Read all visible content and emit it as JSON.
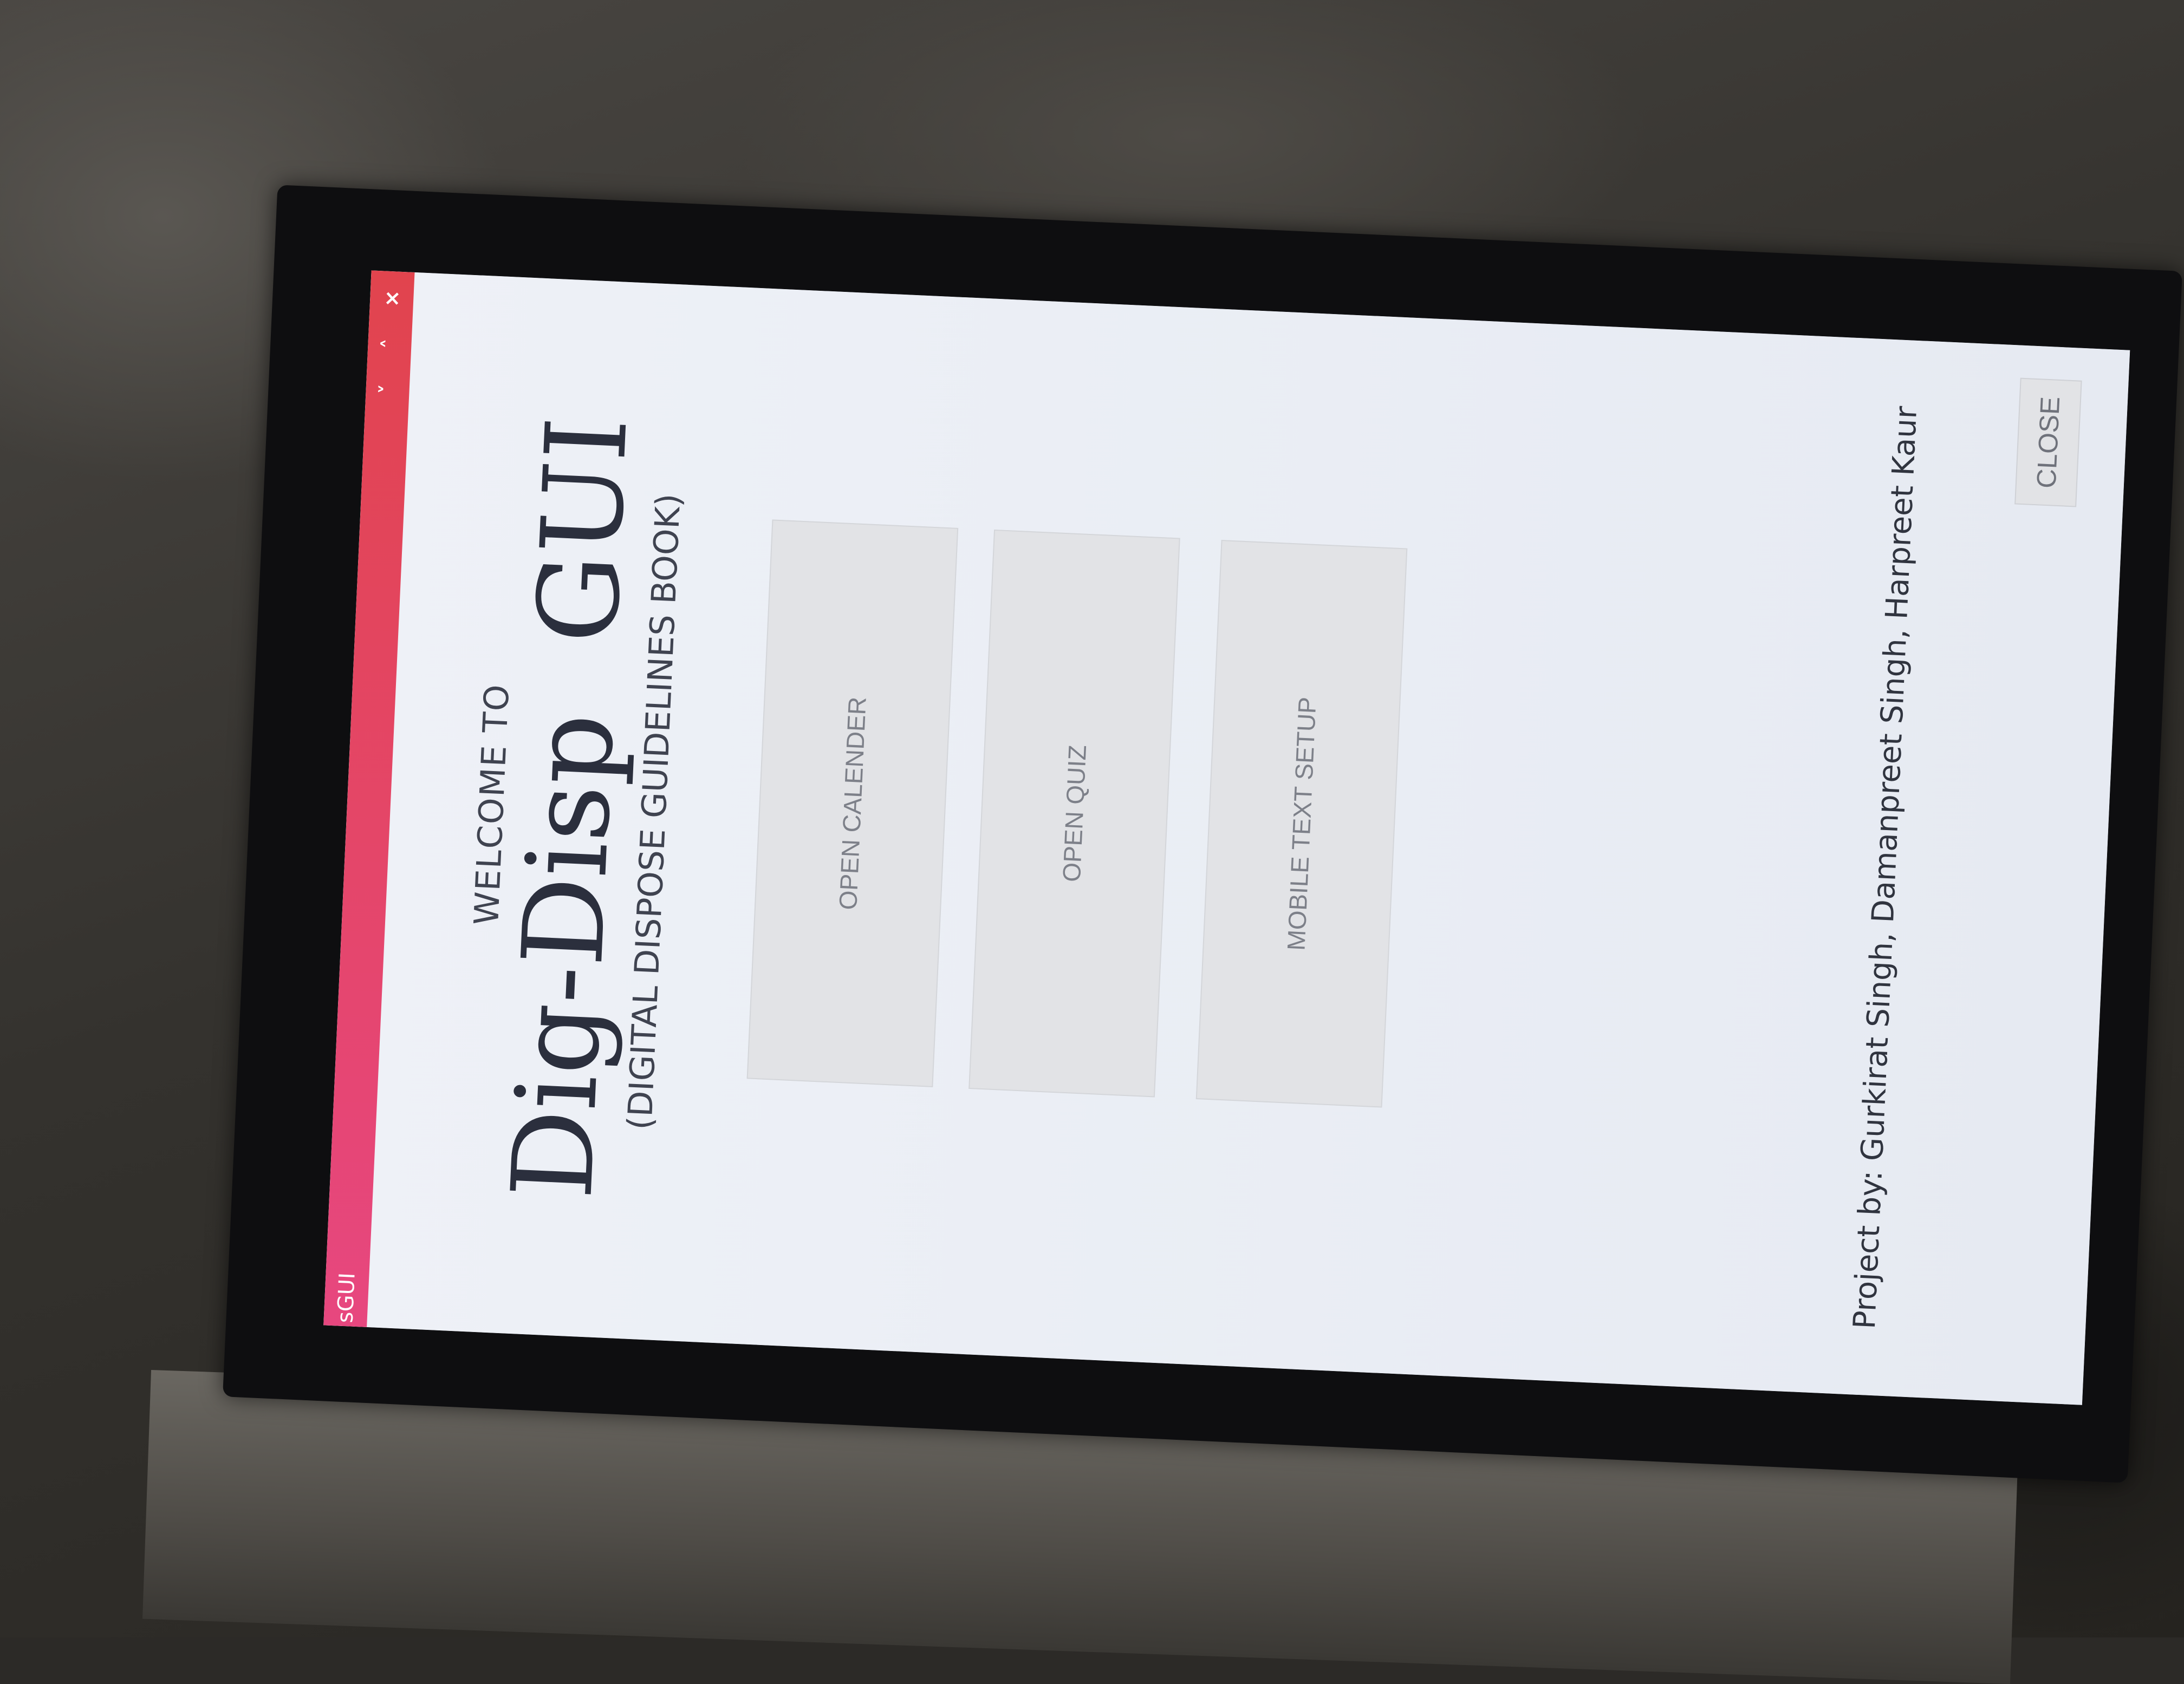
{
  "window": {
    "title": "sGUI",
    "controls": {
      "minimize": "˅",
      "maximize": "˄",
      "close": "×"
    }
  },
  "header": {
    "welcome": "WELCOME TO",
    "app_name": "Dig-Disp  GUI",
    "subtitle": "(DIGITAL DISPOSE GUIDELINES BOOK)"
  },
  "buttons": {
    "calendar": "OPEN CALENDER",
    "quiz": "OPEN QUIZ",
    "mobile_text": "MOBILE TEXT SETUP",
    "close": "CLOSE"
  },
  "footer": {
    "credits": "Project by: Gurkirat Singh, Damanpreet Singh, Harpreet Kaur"
  },
  "colors": {
    "titlebar_start": "#e7477f",
    "titlebar_end": "#e1444e",
    "window_bg": "#eef1f7",
    "button_bg": "#e2e3e6"
  }
}
